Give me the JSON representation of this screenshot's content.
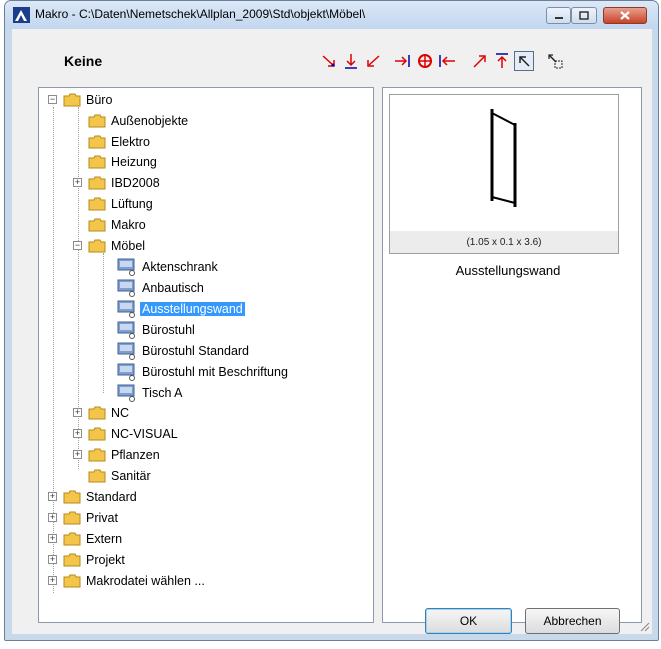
{
  "window": {
    "title": "Makro - C:\\Daten\\Nemetschek\\Allplan_2009\\Std\\objekt\\Möbel\\"
  },
  "header": {
    "label": "Keine"
  },
  "toolbar": {
    "icons": [
      "align-bottom-right-icon",
      "align-bottom-icon",
      "align-bottom-left-icon",
      "align-right-icon",
      "align-center-icon",
      "align-left-icon",
      "align-top-right-icon",
      "align-top-icon",
      "align-top-left-icon",
      "preview-toggle-icon"
    ]
  },
  "tree": {
    "items": [
      {
        "label": "Büro",
        "type": "folder",
        "level": 1,
        "expander": "minus"
      },
      {
        "label": "Außenobjekte",
        "type": "folder",
        "level": 2
      },
      {
        "label": "Elektro",
        "type": "folder",
        "level": 2
      },
      {
        "label": "Heizung",
        "type": "folder",
        "level": 2
      },
      {
        "label": "IBD2008",
        "type": "folder",
        "level": 2,
        "expander": "plus"
      },
      {
        "label": "Lüftung",
        "type": "folder",
        "level": 2
      },
      {
        "label": "Makro",
        "type": "folder",
        "level": 2
      },
      {
        "label": "Möbel",
        "type": "folder",
        "level": 2,
        "expander": "minus"
      },
      {
        "label": "Aktenschrank",
        "type": "macro",
        "level": 3
      },
      {
        "label": "Anbautisch",
        "type": "macro",
        "level": 3
      },
      {
        "label": "Ausstellungswand",
        "type": "macro",
        "level": 3,
        "selected": true
      },
      {
        "label": "Bürostuhl",
        "type": "macro",
        "level": 3
      },
      {
        "label": "Bürostuhl Standard",
        "type": "macro",
        "level": 3
      },
      {
        "label": "Bürostuhl mit Beschriftung",
        "type": "macro",
        "level": 3
      },
      {
        "label": "Tisch A",
        "type": "macro",
        "level": 3
      },
      {
        "label": "NC",
        "type": "folder",
        "level": 2,
        "expander": "plus"
      },
      {
        "label": "NC-VISUAL",
        "type": "folder",
        "level": 2,
        "expander": "plus"
      },
      {
        "label": "Pflanzen",
        "type": "folder",
        "level": 2,
        "expander": "plus"
      },
      {
        "label": "Sanitär",
        "type": "folder",
        "level": 2
      },
      {
        "label": "Standard",
        "type": "folder",
        "level": 1,
        "expander": "plus"
      },
      {
        "label": "Privat",
        "type": "folder",
        "level": 1,
        "expander": "plus"
      },
      {
        "label": "Extern",
        "type": "folder",
        "level": 1,
        "expander": "plus"
      },
      {
        "label": "Projekt",
        "type": "folder",
        "level": 1,
        "expander": "plus"
      },
      {
        "label": "Makrodatei wählen ...",
        "type": "folder",
        "level": 1,
        "expander": "plus"
      }
    ]
  },
  "preview": {
    "dimensions": "(1.05 x 0.1 x 3.6)",
    "name": "Ausstellungswand"
  },
  "buttons": {
    "ok": "OK",
    "cancel": "Abbrechen"
  },
  "colors": {
    "selection": "#3399ff",
    "folder": "#f3c54a",
    "close_button": "#c7432a"
  }
}
